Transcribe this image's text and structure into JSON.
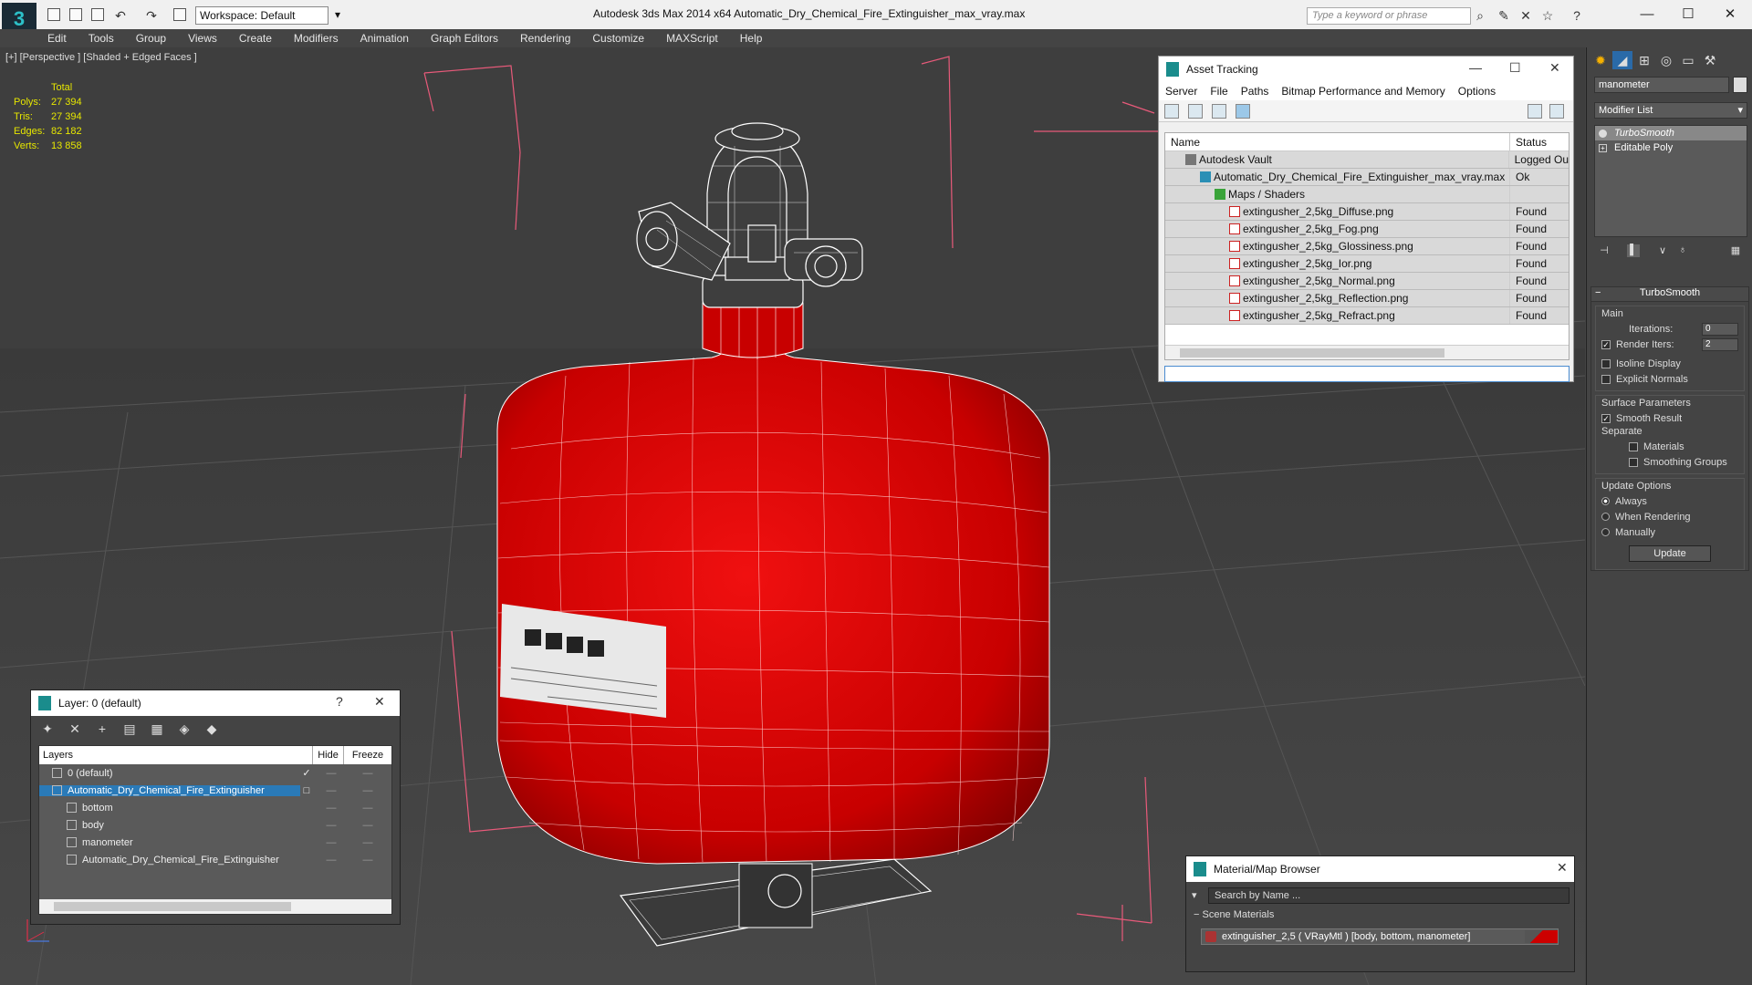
{
  "titlebar": {
    "workspace": "Workspace: Default",
    "window_title": "Autodesk 3ds Max  2014 x64      Automatic_Dry_Chemical_Fire_Extinguisher_max_vray.max",
    "search_placeholder": "Type a keyword or phrase"
  },
  "menu": [
    "Edit",
    "Tools",
    "Group",
    "Views",
    "Create",
    "Modifiers",
    "Animation",
    "Graph Editors",
    "Rendering",
    "Customize",
    "MAXScript",
    "Help"
  ],
  "viewport": {
    "label": "[+] [Perspective ] [Shaded + Edged Faces ]",
    "stats": {
      "total_label": "Total",
      "rows": [
        {
          "k": "Polys:",
          "v": "27 394"
        },
        {
          "k": "Tris:",
          "v": "27 394"
        },
        {
          "k": "Edges:",
          "v": "82 182"
        },
        {
          "k": "Verts:",
          "v": "13 858"
        }
      ]
    }
  },
  "asset_tracking": {
    "title": "Asset Tracking",
    "menu": [
      "Server",
      "File",
      "Paths",
      "Bitmap Performance and Memory",
      "Options"
    ],
    "col_name": "Name",
    "col_status": "Status",
    "rows": [
      {
        "indent": 22,
        "icon": "vault",
        "name": "Autodesk Vault",
        "status": "Logged Ou"
      },
      {
        "indent": 38,
        "icon": "max",
        "name": "Automatic_Dry_Chemical_Fire_Extinguisher_max_vray.max",
        "status": "Ok"
      },
      {
        "indent": 54,
        "icon": "maps",
        "name": "Maps / Shaders",
        "status": ""
      },
      {
        "indent": 70,
        "icon": "png",
        "name": "extingusher_2,5kg_Diffuse.png",
        "status": "Found"
      },
      {
        "indent": 70,
        "icon": "png",
        "name": "extingusher_2,5kg_Fog.png",
        "status": "Found"
      },
      {
        "indent": 70,
        "icon": "png",
        "name": "extingusher_2,5kg_Glossiness.png",
        "status": "Found"
      },
      {
        "indent": 70,
        "icon": "png",
        "name": "extingusher_2,5kg_Ior.png",
        "status": "Found"
      },
      {
        "indent": 70,
        "icon": "png",
        "name": "extingusher_2,5kg_Normal.png",
        "status": "Found"
      },
      {
        "indent": 70,
        "icon": "png",
        "name": "extingusher_2,5kg_Reflection.png",
        "status": "Found"
      },
      {
        "indent": 70,
        "icon": "png",
        "name": "extingusher_2,5kg_Refract.png",
        "status": "Found"
      }
    ]
  },
  "layers": {
    "title": "Layer: 0 (default)",
    "col_layers": "Layers",
    "col_hide": "Hide",
    "col_freeze": "Freeze",
    "rows": [
      {
        "indent": 14,
        "name": "0 (default)",
        "selected": false,
        "mark": "✓"
      },
      {
        "indent": 14,
        "name": "Automatic_Dry_Chemical_Fire_Extinguisher",
        "selected": true,
        "mark": "□"
      },
      {
        "indent": 30,
        "name": "bottom",
        "selected": false,
        "mark": ""
      },
      {
        "indent": 30,
        "name": "body",
        "selected": false,
        "mark": ""
      },
      {
        "indent": 30,
        "name": "manometer",
        "selected": false,
        "mark": ""
      },
      {
        "indent": 30,
        "name": "Automatic_Dry_Chemical_Fire_Extinguisher",
        "selected": false,
        "mark": ""
      }
    ]
  },
  "material_browser": {
    "title": "Material/Map Browser",
    "search_placeholder": "Search by Name ...",
    "group": "Scene Materials",
    "item": "extinguisher_2,5  ( VRayMtl )  [body, bottom, manometer]"
  },
  "command_panel": {
    "object_name": "manometer",
    "modifier_list": "Modifier List",
    "stack": [
      {
        "label": "TurboSmooth",
        "active": true
      },
      {
        "label": "Editable Poly",
        "active": false
      }
    ],
    "rollout_title": "TurboSmooth",
    "main_label": "Main",
    "iterations_label": "Iterations:",
    "iterations_value": "0",
    "render_iters_label": "Render Iters:",
    "render_iters_value": "2",
    "isoline_label": "Isoline Display",
    "explicit_normals_label": "Explicit Normals",
    "surface_label": "Surface Parameters",
    "smooth_result_label": "Smooth Result",
    "separate_label": "Separate",
    "materials_label": "Materials",
    "smoothing_groups_label": "Smoothing Groups",
    "update_options_label": "Update Options",
    "always_label": "Always",
    "when_rendering_label": "When Rendering",
    "manually_label": "Manually",
    "update_button": "Update"
  },
  "colors": {
    "extinguisher_red": "#d40000",
    "stats_yellow": "#e6e600",
    "selection_blue": "#2a7ab8"
  }
}
